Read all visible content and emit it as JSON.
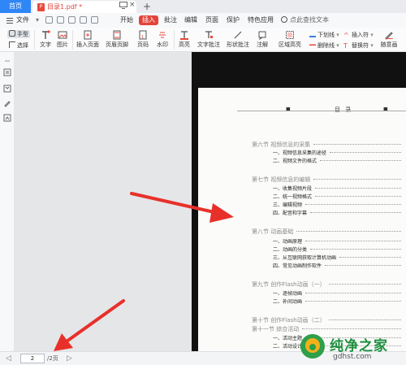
{
  "tabs": {
    "home": "首页",
    "document": "目录1.pdf *"
  },
  "menu": {
    "file": "文件",
    "items": [
      "开始",
      "插入",
      "批注",
      "编辑",
      "页面",
      "保护",
      "特色应用"
    ],
    "active": "插入",
    "search": "点此查找文本"
  },
  "ribbon": {
    "hand": "手型",
    "select": "选择",
    "text": "文字",
    "image": "图片",
    "insert_page": "插入页面",
    "header_footer": "页眉页脚",
    "page_number": "页码",
    "watermark": "水印",
    "highlight": "高亮",
    "text_comment": "文字批注",
    "shape_comment": "形状批注",
    "comment": "注解",
    "area_highlight": "区域高亮",
    "underline": "下划线",
    "strikethrough": "删除线",
    "insert_char": "插入符",
    "replace_char": "替换符",
    "random_line": "随意画"
  },
  "document": {
    "header_title": "目 录",
    "entries": [
      {
        "text": "第六节  视频信息的采集",
        "kind": "sec"
      },
      {
        "text": "一、视频信息采集的途径",
        "kind": "sub"
      },
      {
        "text": "二、视频文件的格式",
        "kind": "sub"
      },
      {
        "text": "第七节  视频信息的编辑",
        "kind": "sec"
      },
      {
        "text": "一、收集视频片段",
        "kind": "sub"
      },
      {
        "text": "二、统一视频格式",
        "kind": "sub"
      },
      {
        "text": "三、编辑视频",
        "kind": "sub"
      },
      {
        "text": "四、配音和字幕",
        "kind": "sub"
      },
      {
        "text": "第八节  动画基础",
        "kind": "sec"
      },
      {
        "text": "一、动画原理",
        "kind": "sub"
      },
      {
        "text": "二、动画的分类",
        "kind": "sub"
      },
      {
        "text": "三、从互联网获取计算机动画",
        "kind": "sub"
      },
      {
        "text": "四、常见动画制作软件",
        "kind": "sub"
      },
      {
        "text": "第九节  创作Flash动画（一）",
        "kind": "sec"
      },
      {
        "text": "一、逐帧动画",
        "kind": "sub"
      },
      {
        "text": "二、补间动画",
        "kind": "sub"
      },
      {
        "text": "第十节  创作Flash动画（二）",
        "kind": "sec"
      },
      {
        "text": "第十一节  综合活动",
        "kind": "sec"
      },
      {
        "text": "一、活动主题",
        "kind": "sub"
      },
      {
        "text": "二、活动设计",
        "kind": "sub"
      }
    ]
  },
  "statusbar": {
    "page_value": "2",
    "page_total": "/2页"
  },
  "watermark": {
    "name": "纯净之家",
    "url": "gdhst.com"
  },
  "colors": {
    "accent_blue": "#2f86f6",
    "insert_tab_red": "#e3433a",
    "arrow_red": "#e8302a",
    "watermark_green": "#1e8f3f"
  }
}
